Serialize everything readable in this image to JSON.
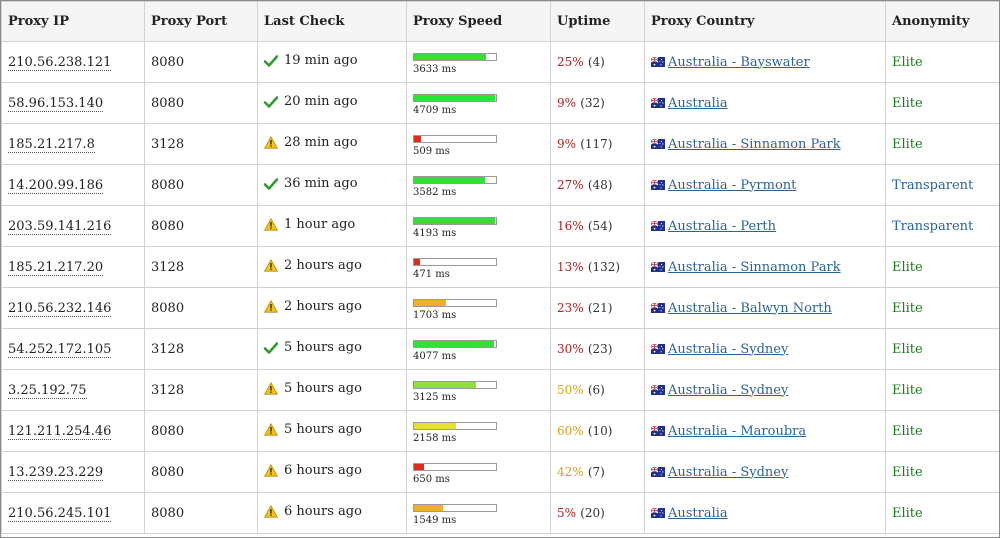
{
  "colors": {
    "elite": "#1e7a1e",
    "transparent": "#2563a6",
    "speed_fast": "#33e033",
    "speed_mid": "#8ee03a",
    "speed_slow_yellow": "#e6e032",
    "speed_slow_orange": "#efb030",
    "speed_very_slow": "#d9301e",
    "uptime_low": "#b22222",
    "uptime_mid": "#d4a017",
    "check_green": "#2e9d2e",
    "warning_yellow": "#f0c419"
  },
  "headers": {
    "ip": "Proxy IP",
    "port": "Proxy Port",
    "last_check": "Last Check",
    "speed": "Proxy Speed",
    "uptime": "Uptime",
    "country": "Proxy Country",
    "anonymity": "Anonymity"
  },
  "rows": [
    {
      "ip": "210.56.238.121",
      "port": "8080",
      "status_icon": "check-icon",
      "last_check": "19 min ago",
      "speed_ms": "3633 ms",
      "speed_fraction": 0.88,
      "speed_color": "#33e033",
      "uptime_pct": "25%",
      "uptime_count": "(4)",
      "uptime_color": "#b22222",
      "country": "Australia - Bayswater",
      "anonymity": "Elite",
      "anon_color": "#1e7a1e"
    },
    {
      "ip": "58.96.153.140",
      "port": "8080",
      "status_icon": "check-icon",
      "last_check": "20 min ago",
      "speed_ms": "4709 ms",
      "speed_fraction": 0.99,
      "speed_color": "#33e033",
      "uptime_pct": "9%",
      "uptime_count": "(32)",
      "uptime_color": "#b22222",
      "country": "Australia",
      "anonymity": "Elite",
      "anon_color": "#1e7a1e"
    },
    {
      "ip": "185.21.217.8",
      "port": "3128",
      "status_icon": "warning-icon",
      "last_check": "28 min ago",
      "speed_ms": "509 ms",
      "speed_fraction": 0.08,
      "speed_color": "#d9301e",
      "uptime_pct": "9%",
      "uptime_count": "(117)",
      "uptime_color": "#b22222",
      "country": "Australia - Sinnamon Park",
      "anonymity": "Elite",
      "anon_color": "#1e7a1e"
    },
    {
      "ip": "14.200.99.186",
      "port": "8080",
      "status_icon": "check-icon",
      "last_check": "36 min ago",
      "speed_ms": "3582 ms",
      "speed_fraction": 0.87,
      "speed_color": "#33e033",
      "uptime_pct": "27%",
      "uptime_count": "(48)",
      "uptime_color": "#b22222",
      "country": "Australia - Pyrmont",
      "anonymity": "Transparent",
      "anon_color": "#2563a6"
    },
    {
      "ip": "203.59.141.216",
      "port": "8080",
      "status_icon": "warning-icon",
      "last_check": "1 hour ago",
      "speed_ms": "4193 ms",
      "speed_fraction": 0.99,
      "speed_color": "#33e033",
      "uptime_pct": "16%",
      "uptime_count": "(54)",
      "uptime_color": "#b22222",
      "country": "Australia - Perth",
      "anonymity": "Transparent",
      "anon_color": "#2563a6"
    },
    {
      "ip": "185.21.217.20",
      "port": "3128",
      "status_icon": "warning-icon",
      "last_check": "2 hours ago",
      "speed_ms": "471 ms",
      "speed_fraction": 0.07,
      "speed_color": "#d9301e",
      "uptime_pct": "13%",
      "uptime_count": "(132)",
      "uptime_color": "#b22222",
      "country": "Australia - Sinnamon Park",
      "anonymity": "Elite",
      "anon_color": "#1e7a1e"
    },
    {
      "ip": "210.56.232.146",
      "port": "8080",
      "status_icon": "warning-icon",
      "last_check": "2 hours ago",
      "speed_ms": "1703 ms",
      "speed_fraction": 0.39,
      "speed_color": "#efb030",
      "uptime_pct": "23%",
      "uptime_count": "(21)",
      "uptime_color": "#b22222",
      "country": "Australia - Balwyn North",
      "anonymity": "Elite",
      "anon_color": "#1e7a1e"
    },
    {
      "ip": "54.252.172.105",
      "port": "3128",
      "status_icon": "check-icon",
      "last_check": "5 hours ago",
      "speed_ms": "4077 ms",
      "speed_fraction": 0.97,
      "speed_color": "#33e033",
      "uptime_pct": "30%",
      "uptime_count": "(23)",
      "uptime_color": "#b22222",
      "country": "Australia - Sydney",
      "anonymity": "Elite",
      "anon_color": "#1e7a1e"
    },
    {
      "ip": "3.25.192.75",
      "port": "3128",
      "status_icon": "warning-icon",
      "last_check": "5 hours ago",
      "speed_ms": "3125 ms",
      "speed_fraction": 0.76,
      "speed_color": "#8ee03a",
      "uptime_pct": "50%",
      "uptime_count": "(6)",
      "uptime_color": "#d4a017",
      "country": "Australia - Sydney",
      "anonymity": "Elite",
      "anon_color": "#1e7a1e"
    },
    {
      "ip": "121.211.254.46",
      "port": "8080",
      "status_icon": "warning-icon",
      "last_check": "5 hours ago",
      "speed_ms": "2158 ms",
      "speed_fraction": 0.51,
      "speed_color": "#e6e032",
      "uptime_pct": "60%",
      "uptime_count": "(10)",
      "uptime_color": "#d4a017",
      "country": "Australia - Maroubra",
      "anonymity": "Elite",
      "anon_color": "#1e7a1e"
    },
    {
      "ip": "13.239.23.229",
      "port": "8080",
      "status_icon": "warning-icon",
      "last_check": "6 hours ago",
      "speed_ms": "650 ms",
      "speed_fraction": 0.12,
      "speed_color": "#d9301e",
      "uptime_pct": "42%",
      "uptime_count": "(7)",
      "uptime_color": "#d4a017",
      "country": "Australia - Sydney",
      "anonymity": "Elite",
      "anon_color": "#1e7a1e"
    },
    {
      "ip": "210.56.245.101",
      "port": "8080",
      "status_icon": "warning-icon",
      "last_check": "6 hours ago",
      "speed_ms": "1549 ms",
      "speed_fraction": 0.35,
      "speed_color": "#efb030",
      "uptime_pct": "5%",
      "uptime_count": "(20)",
      "uptime_color": "#b22222",
      "country": "Australia",
      "anonymity": "Elite",
      "anon_color": "#1e7a1e"
    }
  ]
}
